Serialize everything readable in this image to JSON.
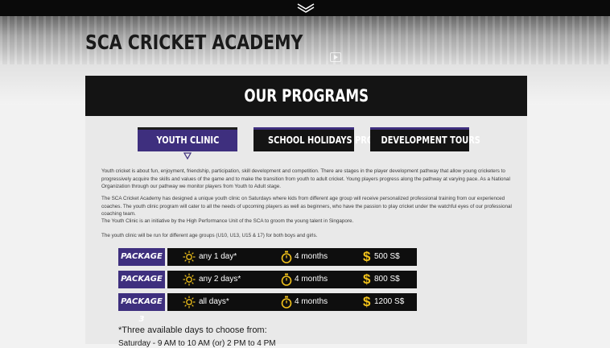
{
  "header": {
    "brand": "SCA CRICKET ACADEMY"
  },
  "section": {
    "title": "OUR PROGRAMS"
  },
  "tabs": [
    {
      "label": "YOUTH CLINIC",
      "active": true
    },
    {
      "label": "SCHOOL HOLIDAYS PROGRAM",
      "active": false
    },
    {
      "label": "DEVELOPMENT TOURS",
      "active": false
    }
  ],
  "paragraphs": [
    "Youth cricket is about fun, enjoyment, friendship, participation, skill development and competition. There are stages in the player development pathway that allow young cricketers to progressively acquire the skills and values of the game and to make the transition from youth to adult cricket. Young players progress along the pathway at varying pace. As a National Organization through our pathway we monitor players from Youth to Adult stage.",
    "The SCA Cricket Academy has designed a unique youth clinic on Saturdays where kids from different age group will receive personalized professional training from our experienced coaches. The youth clinic program will cater to all the needs of upcoming players as well as beginners, who have the passion to play cricket under the watchful eyes of our professional coaching team.",
    "The Youth Clinic is an initiative by the High Performance Unit of the SCA to groom the young talent in Singapore.",
    "The youth clinic will be run for different age groups (U10, U13, U15 & 17) for both boys and girls."
  ],
  "packages": [
    {
      "label": "PACKAGE 1",
      "days": "any 1 day*",
      "duration": "4 months",
      "currency_icon": "$",
      "price": "500 S$"
    },
    {
      "label": "PACKAGE 2",
      "days": "any 2 days*",
      "duration": "4 months",
      "currency_icon": "$",
      "price": "800 S$"
    },
    {
      "label": "PACKAGE 3",
      "days": "all days*",
      "duration": "4 months",
      "currency_icon": "$",
      "price": "1200 S$"
    }
  ],
  "days_note": {
    "heading": "*Three available days to choose from:",
    "first_line": "Saturday - 9 AM to 10 AM (or) 2 PM to 4 PM"
  },
  "colors": {
    "accent": "#3e2f7e",
    "dark": "#141414",
    "gold": "#f2c21b"
  },
  "icons": {
    "scroll": "chevron-down-icon",
    "days": "sun-icon",
    "duration": "stopwatch-icon",
    "price": "dollar-icon"
  }
}
